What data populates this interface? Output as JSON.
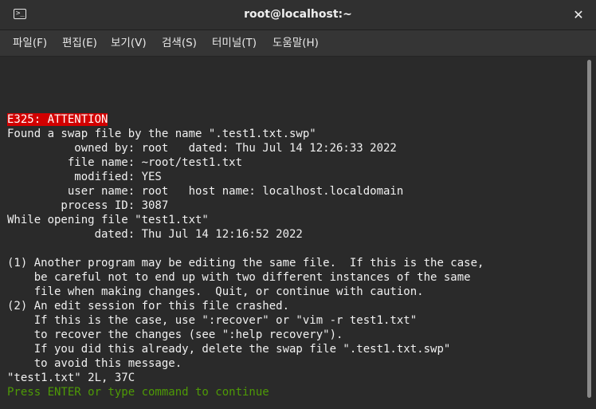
{
  "window": {
    "title": "root@localhost:~",
    "close_glyph": "✕",
    "terminal_glyph": ">_"
  },
  "menu": {
    "items": [
      {
        "label": "파일(F)"
      },
      {
        "label": "편집(E)"
      },
      {
        "label": "보기(V)"
      },
      {
        "label": "검색(S)"
      },
      {
        "label": "터미널(T)"
      },
      {
        "label": "도움말(H)"
      }
    ]
  },
  "terminal": {
    "attention": "E325: ATTENTION",
    "lines": [
      "Found a swap file by the name \".test1.txt.swp\"",
      "          owned by: root   dated: Thu Jul 14 12:26:33 2022",
      "         file name: ~root/test1.txt",
      "          modified: YES",
      "         user name: root   host name: localhost.localdomain",
      "        process ID: 3087",
      "While opening file \"test1.txt\"",
      "             dated: Thu Jul 14 12:16:52 2022",
      "",
      "(1) Another program may be editing the same file.  If this is the case,",
      "    be careful not to end up with two different instances of the same",
      "    file when making changes.  Quit, or continue with caution.",
      "(2) An edit session for this file crashed.",
      "    If this is the case, use \":recover\" or \"vim -r test1.txt\"",
      "    to recover the changes (see \":help recovery\").",
      "    If you did this already, delete the swap file \".test1.txt.swp\"",
      "    to avoid this message.",
      "\"test1.txt\" 2L, 37C"
    ],
    "prompt": "Press ENTER or type command to continue"
  },
  "colors": {
    "attention_bg": "#d20000",
    "prompt_fg": "#4e9a06",
    "terminal_bg": "#2a2a2a"
  }
}
